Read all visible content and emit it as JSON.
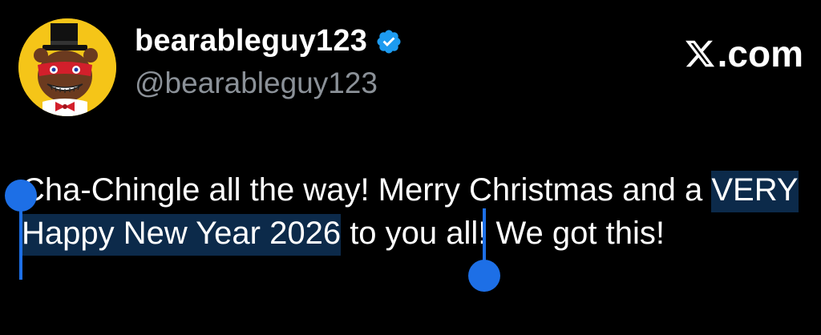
{
  "author": {
    "display_name": "bearableguy123",
    "handle": "@bearableguy123",
    "verified": true,
    "avatar_icon": "bear-with-top-hat-avatar"
  },
  "brand": {
    "label": ".com",
    "logo_icon": "x-logo-icon"
  },
  "tweet": {
    "text_before": "Cha-Chingle all the way! Merry Christmas and a ",
    "text_selected": "VERY Happy New Year 2026",
    "text_after": " to you all! We got this!"
  },
  "colors": {
    "background": "#000000",
    "text": "#ffffff",
    "handle": "#8b9198",
    "verified_badge": "#1d9bf0",
    "selection_highlight": "#0c2a4a",
    "selection_handle": "#1d6fe6"
  }
}
